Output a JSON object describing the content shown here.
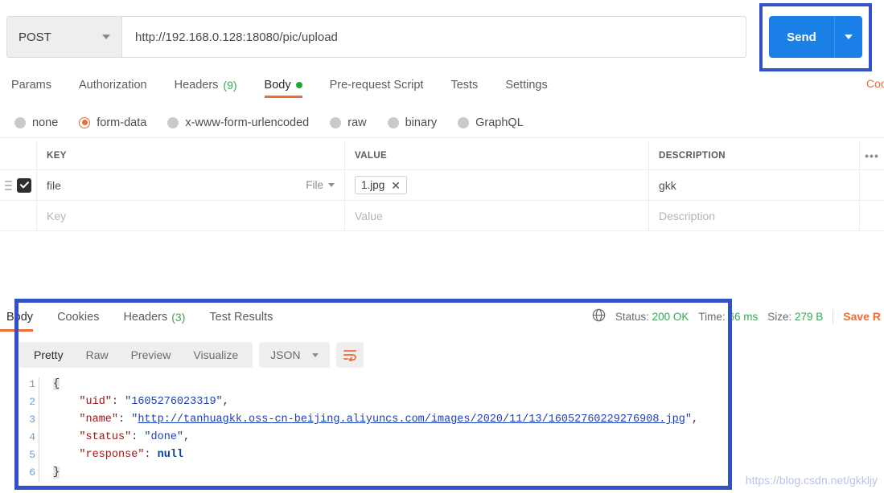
{
  "request": {
    "method": "POST",
    "url": "http://192.168.0.128:18080/pic/upload",
    "send_label": "Send",
    "tabs": [
      {
        "label": "Params",
        "badge": "",
        "dot": false,
        "active": false
      },
      {
        "label": "Authorization",
        "badge": "",
        "dot": false,
        "active": false
      },
      {
        "label": "Headers",
        "badge": "(9)",
        "dot": false,
        "active": false
      },
      {
        "label": "Body",
        "badge": "",
        "dot": true,
        "active": true
      },
      {
        "label": "Pre-request Script",
        "badge": "",
        "dot": false,
        "active": false
      },
      {
        "label": "Tests",
        "badge": "",
        "dot": false,
        "active": false
      },
      {
        "label": "Settings",
        "badge": "",
        "dot": false,
        "active": false
      }
    ],
    "cookies_link": "Cookies",
    "body_types": [
      {
        "label": "none",
        "selected": false
      },
      {
        "label": "form-data",
        "selected": true
      },
      {
        "label": "x-www-form-urlencoded",
        "selected": false
      },
      {
        "label": "raw",
        "selected": false
      },
      {
        "label": "binary",
        "selected": false
      },
      {
        "label": "GraphQL",
        "selected": false
      }
    ],
    "table": {
      "headers": {
        "key": "KEY",
        "value": "VALUE",
        "description": "DESCRIPTION",
        "more": "•••"
      },
      "rows": [
        {
          "checked": true,
          "key": "file",
          "type_label": "File",
          "file_chip": "1.jpg",
          "description": "gkk"
        }
      ],
      "placeholders": {
        "key": "Key",
        "value": "Value",
        "description": "Description"
      }
    }
  },
  "response": {
    "tabs": [
      {
        "label": "Body",
        "badge": "",
        "active": true
      },
      {
        "label": "Cookies",
        "badge": "",
        "active": false
      },
      {
        "label": "Headers",
        "badge": "(3)",
        "active": false
      },
      {
        "label": "Test Results",
        "badge": "",
        "active": false
      }
    ],
    "status": {
      "status_label": "Status:",
      "status_value": "200 OK",
      "time_label": "Time:",
      "time_value": "66",
      "time_unit": "ms",
      "size_label": "Size:",
      "size_value": "279 B",
      "save_label": "Save R"
    },
    "view_modes": [
      {
        "label": "Pretty",
        "active": true
      },
      {
        "label": "Raw",
        "active": false
      },
      {
        "label": "Preview",
        "active": false
      },
      {
        "label": "Visualize",
        "active": false
      }
    ],
    "format": "JSON",
    "body_lines": [
      {
        "n": "1",
        "segments": [
          {
            "t": "{",
            "c": "brace"
          }
        ]
      },
      {
        "n": "2",
        "segments": [
          {
            "t": "    ",
            "c": "tok-punc"
          },
          {
            "t": "\"uid\"",
            "c": "tok-key"
          },
          {
            "t": ": ",
            "c": "tok-punc"
          },
          {
            "t": "\"1605276023319\"",
            "c": "tok-str"
          },
          {
            "t": ",",
            "c": "tok-punc"
          }
        ]
      },
      {
        "n": "3",
        "segments": [
          {
            "t": "    ",
            "c": "tok-punc"
          },
          {
            "t": "\"name\"",
            "c": "tok-key"
          },
          {
            "t": ": ",
            "c": "tok-punc"
          },
          {
            "t": "\"",
            "c": "tok-str"
          },
          {
            "t": "http://tanhuagkk.oss-cn-beijing.aliyuncs.com/images/2020/11/13/16052760229276908.jpg",
            "c": "tok-link"
          },
          {
            "t": "\"",
            "c": "tok-str"
          },
          {
            "t": ",",
            "c": "tok-punc"
          }
        ]
      },
      {
        "n": "4",
        "segments": [
          {
            "t": "    ",
            "c": "tok-punc"
          },
          {
            "t": "\"status\"",
            "c": "tok-key"
          },
          {
            "t": ": ",
            "c": "tok-punc"
          },
          {
            "t": "\"done\"",
            "c": "tok-str"
          },
          {
            "t": ",",
            "c": "tok-punc"
          }
        ]
      },
      {
        "n": "5",
        "segments": [
          {
            "t": "    ",
            "c": "tok-punc"
          },
          {
            "t": "\"response\"",
            "c": "tok-key"
          },
          {
            "t": ": ",
            "c": "tok-punc"
          },
          {
            "t": "null",
            "c": "tok-null"
          }
        ]
      },
      {
        "n": "6",
        "segments": [
          {
            "t": "}",
            "c": "brace"
          }
        ]
      }
    ]
  },
  "watermark": "https://blog.csdn.net/gkkljy",
  "colors": {
    "accent_orange": "#ef6c34",
    "send_blue": "#1a80e8",
    "annotation_blue": "#3250c8",
    "status_green": "#3aa757"
  }
}
